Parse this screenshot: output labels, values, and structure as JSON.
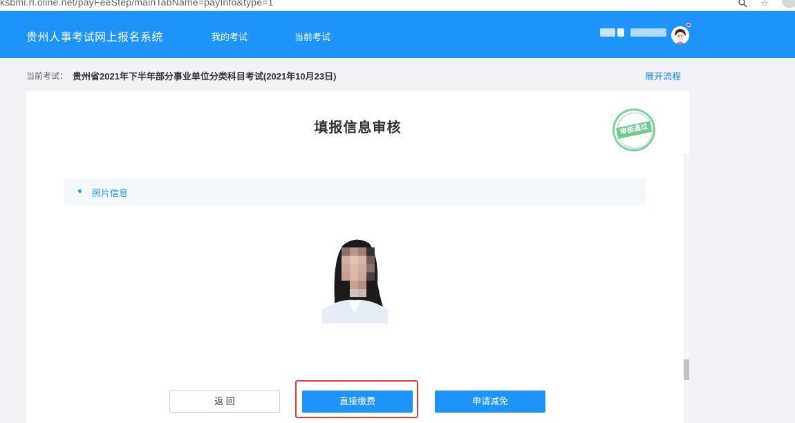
{
  "browser": {
    "url": "ksbmi.rl.oline.net/payFeeStep/mainTabName=payInfo&type=1"
  },
  "header": {
    "site_title": "贵州人事考试网上报名系统",
    "nav": [
      "我的考试",
      "当前考试"
    ]
  },
  "exam_bar": {
    "label": "当前考试：",
    "exam_name": "贵州省2021年下半年部分事业单位分类科目考试(2021年10月23日)",
    "expand_link": "展开流程"
  },
  "card": {
    "title": "填报信息审核",
    "stamp_text": "审核通过",
    "section_title": "照片信息"
  },
  "buttons": {
    "back": "返 回",
    "pay": "直接缴费",
    "reduce": "申请减免"
  },
  "colors": {
    "primary": "#1e94fb",
    "stamp": "#73c992",
    "highlight": "#e53935"
  },
  "icons": [
    "search-icon",
    "star-icon",
    "avatar-icon",
    "notification-dot-icon"
  ]
}
